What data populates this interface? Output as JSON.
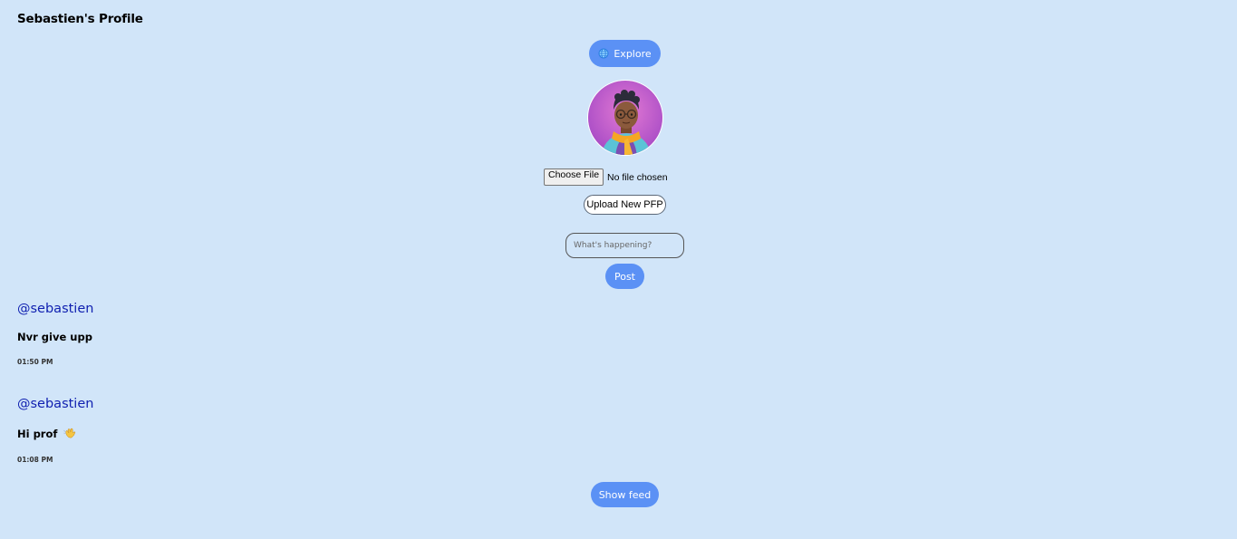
{
  "header": {
    "title": "Sebastien's Profile"
  },
  "nav": {
    "explore_label": "Explore",
    "explore_icon": "globe-icon"
  },
  "profile": {
    "avatar_icon": "avatar-image",
    "choose_file_label": "Choose File",
    "file_status": "No file chosen",
    "upload_label": "Upload New PFP"
  },
  "composer": {
    "placeholder": "What's happening?",
    "post_label": "Post"
  },
  "posts": [
    {
      "author": "@sebastien",
      "text": "Nvr give upp",
      "time": "01:50 PM"
    },
    {
      "author": "@sebastien",
      "text": "Hi prof",
      "emoji_icon": "waving-hand-icon",
      "time": "01:08 PM"
    }
  ],
  "feed": {
    "show_label": "Show feed"
  },
  "colors": {
    "background": "#d1e5f9",
    "button": "#5b91f5",
    "link": "#0f1fb0"
  }
}
